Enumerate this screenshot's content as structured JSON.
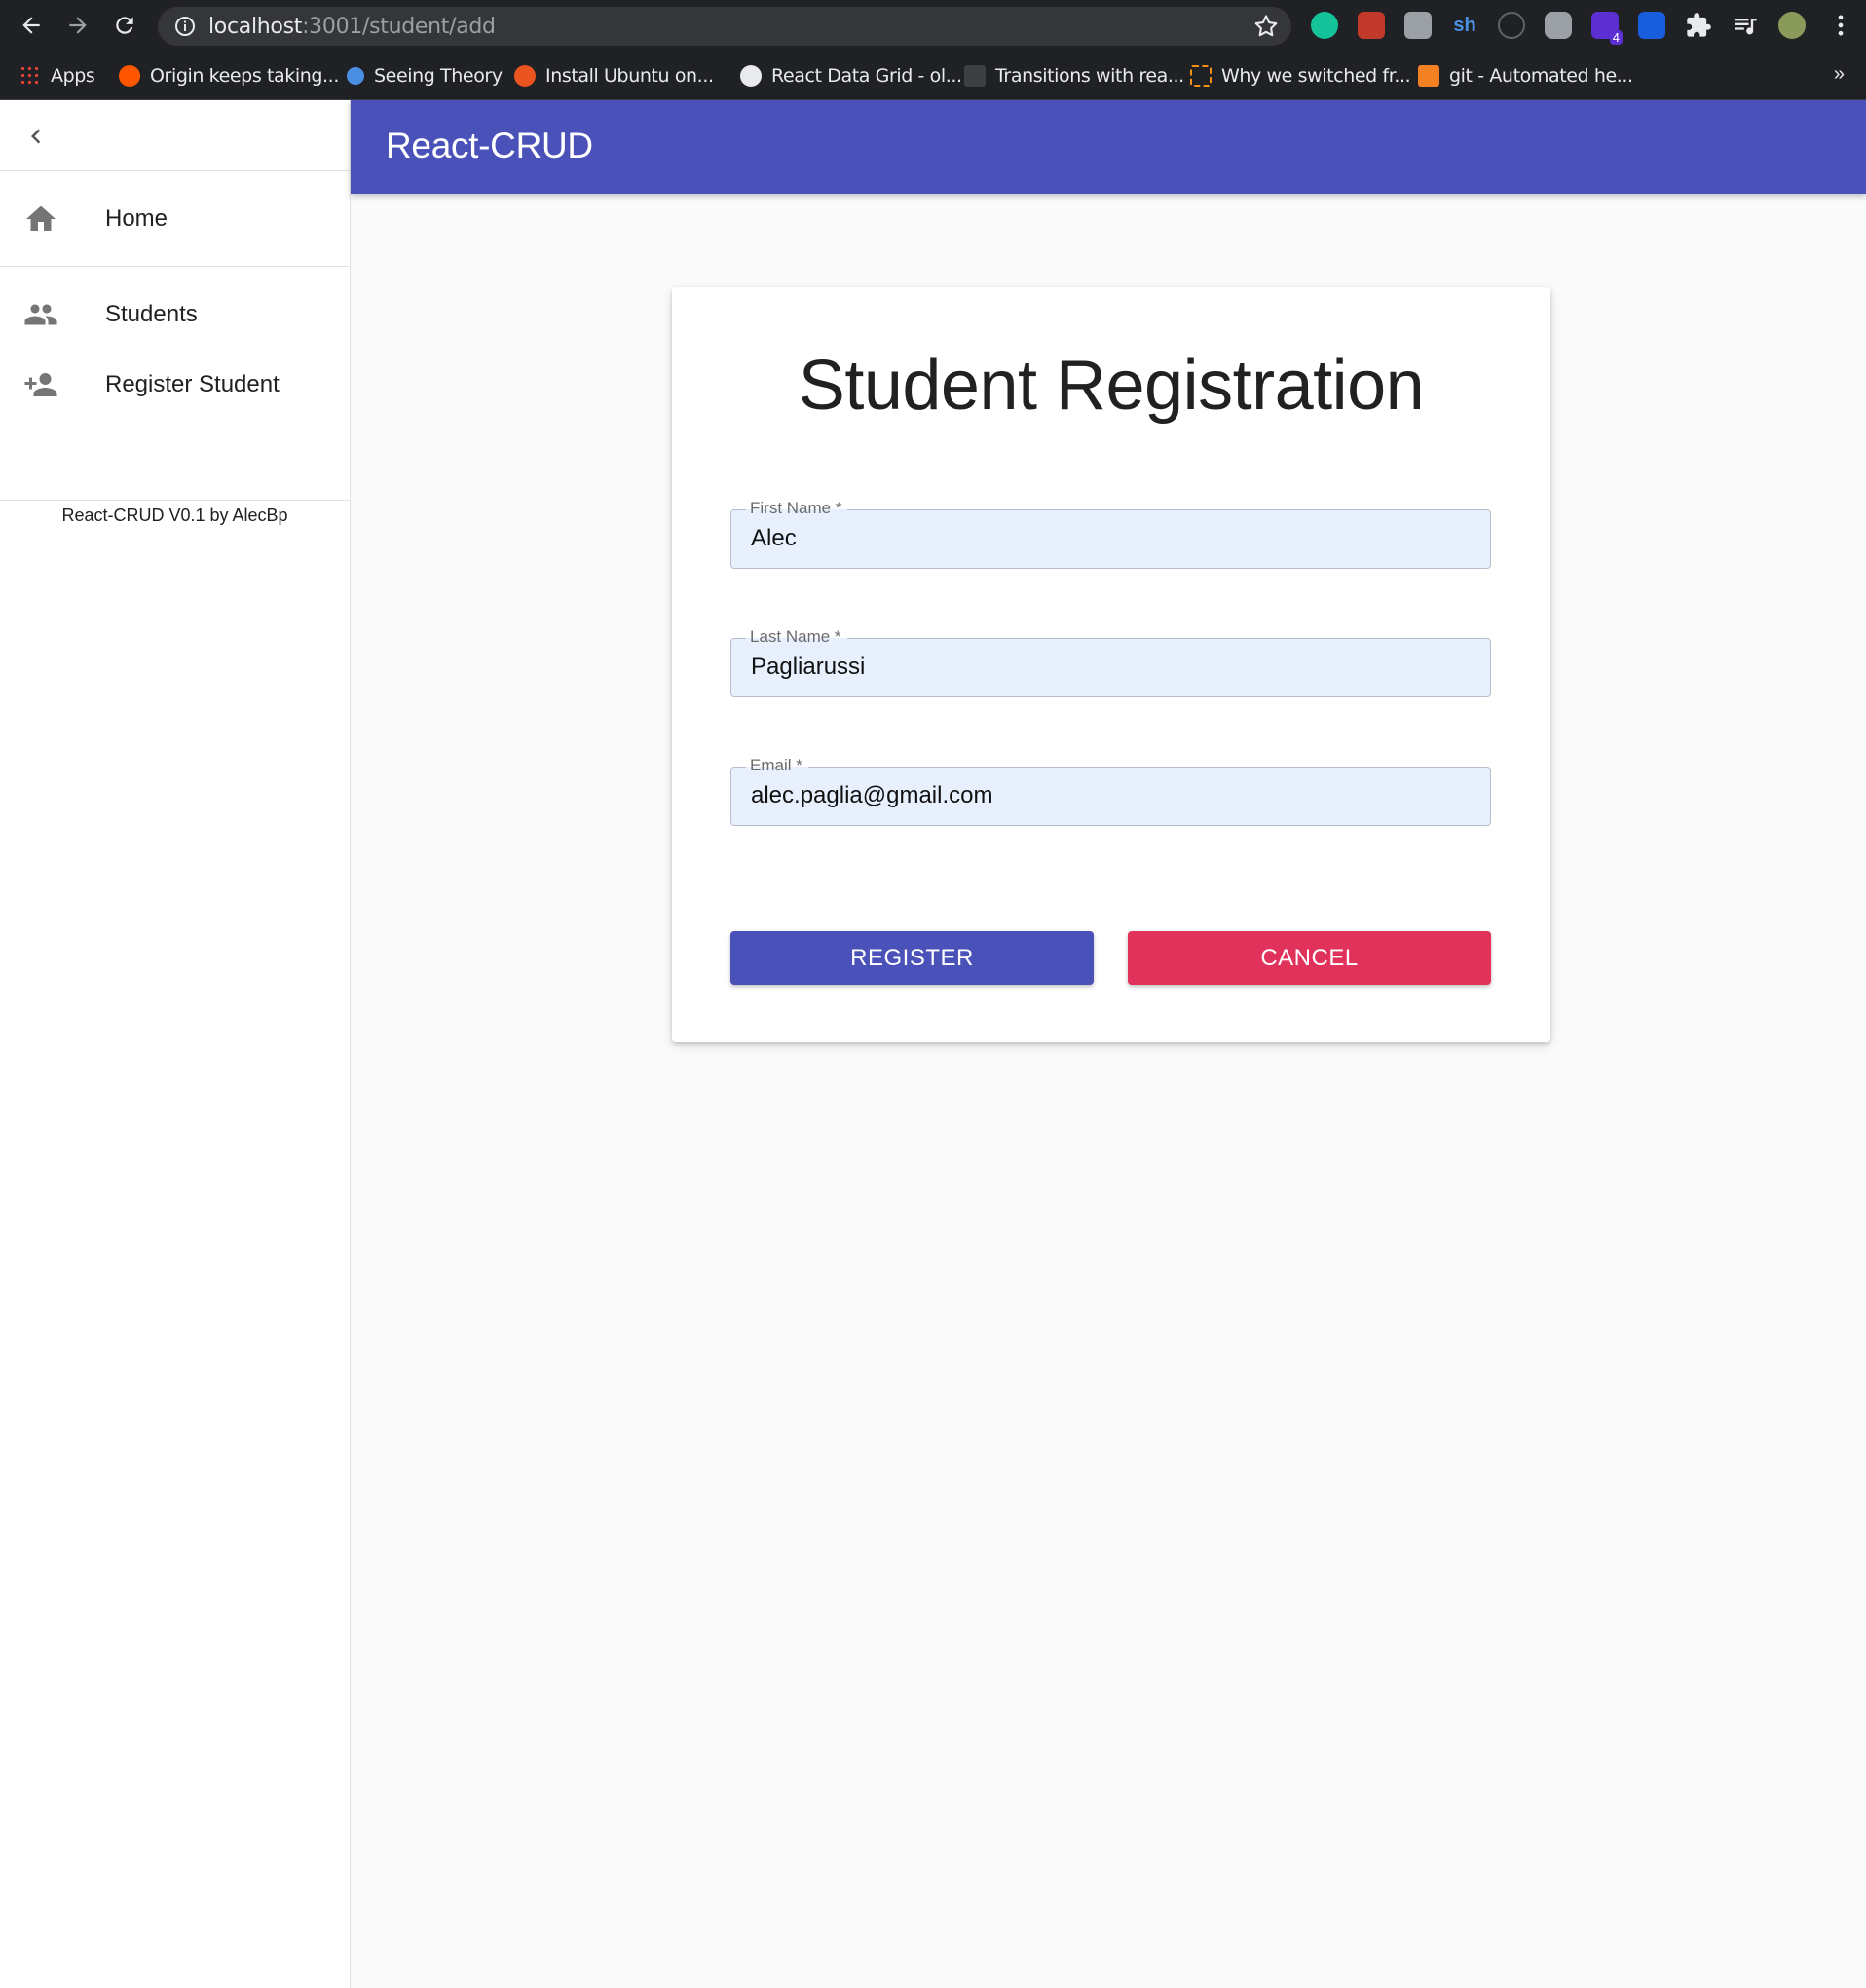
{
  "browser": {
    "url_host": "localhost",
    "url_path": ":3001/student/add",
    "bookmarks": [
      {
        "label": "Apps",
        "color": "#ea4335"
      },
      {
        "label": "Origin keeps taking...",
        "color": "#ff5700"
      },
      {
        "label": "Seeing Theory",
        "color": "#4a90e2"
      },
      {
        "label": "Install Ubuntu on...",
        "color": "#e95420"
      },
      {
        "label": "React Data Grid - ol...",
        "color": "#e8eaed"
      },
      {
        "label": "Transitions with rea...",
        "color": "#3c4043"
      },
      {
        "label": "Why we switched fr...",
        "color": "#f29111"
      },
      {
        "label": "git - Automated he...",
        "color": "#f48024"
      }
    ],
    "more_label": "»",
    "extensions": [
      "grammarly-icon",
      "ublock-icon",
      "extension-icon",
      "sh-icon",
      "sync-icon",
      "camera-icon",
      "badge-icon",
      "bitwarden-icon",
      "puzzle-icon",
      "playlist-icon",
      "profile-avatar",
      "kebab-menu-icon"
    ],
    "extension_badge": "4"
  },
  "sidebar": {
    "items": [
      {
        "label": "Home",
        "icon": "home-icon"
      },
      {
        "label": "Students",
        "icon": "people-icon"
      },
      {
        "label": "Register Student",
        "icon": "person-add-icon"
      }
    ],
    "footer": "React-CRUD V0.1 by AlecBp"
  },
  "appbar": {
    "title": "React-CRUD",
    "color": "#4a51b8"
  },
  "form": {
    "title": "Student Registration",
    "fields": [
      {
        "label": "First Name *",
        "value": "Alec"
      },
      {
        "label": "Last Name *",
        "value": "Pagliarussi"
      },
      {
        "label": "Email *",
        "value": "alec.paglia@gmail.com"
      }
    ],
    "register_label": "REGISTER",
    "cancel_label": "CANCEL",
    "register_color": "#4a51b8",
    "cancel_color": "#e0325a"
  }
}
